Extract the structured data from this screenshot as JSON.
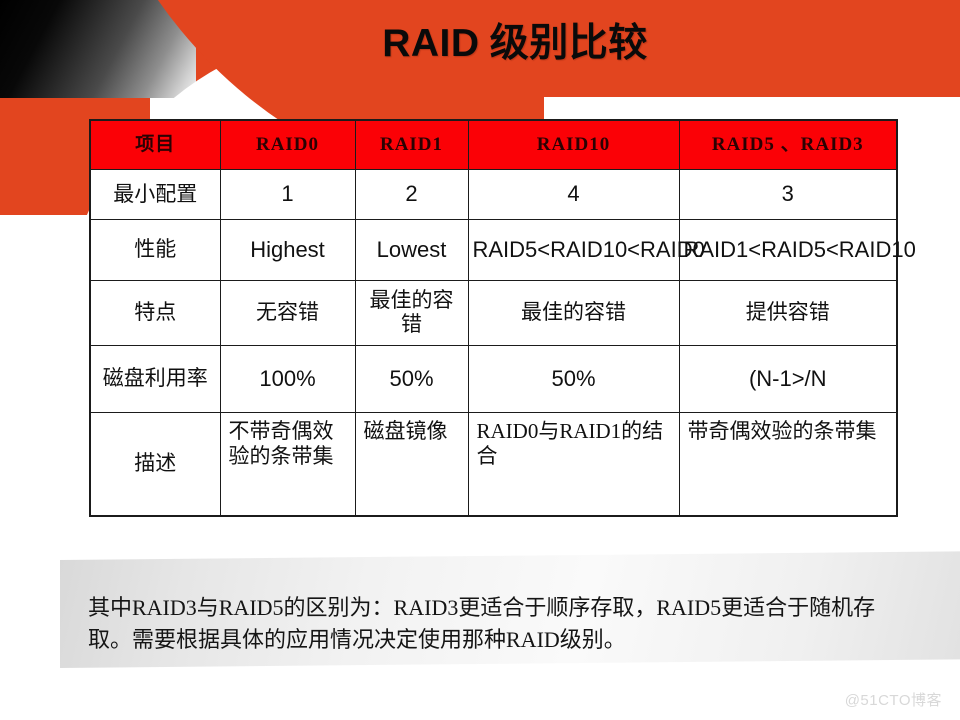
{
  "slide": {
    "title_latin": "RAID",
    "title_cjk": " 级别比较"
  },
  "table": {
    "headers": [
      "项目",
      "RAID0",
      "RAID1",
      "RAID10",
      "RAID5 、RAID3"
    ],
    "rows": [
      {
        "label": "最小配置",
        "cells": [
          "1",
          "2",
          "4",
          "3"
        ]
      },
      {
        "label": "性能",
        "cells": [
          "Highest",
          "Lowest",
          "RAID5<RAID10<RAID0",
          "RAID1<RAID5<RAID10"
        ]
      },
      {
        "label": "特点",
        "cells": [
          "无容错",
          "最佳的容错",
          "最佳的容错",
          "提供容错"
        ]
      },
      {
        "label": "磁盘利用率",
        "cells": [
          "100%",
          "50%",
          "50%",
          "(N-1>/N"
        ]
      },
      {
        "label": "描述",
        "cells": [
          "不带奇偶效验的条带集",
          "磁盘镜像",
          "RAID0与RAID1的结合",
          "带奇偶效验的条带集"
        ]
      }
    ]
  },
  "note": {
    "line1_a": "其中",
    "line1_b": "RAID3",
    "line1_c": "与",
    "line1_d": "RAID5",
    "line1_e": "的区别为：",
    "line1_f": "RAID3",
    "line1_g": "更适合于顺序存取，",
    "line1_h": "RAID5",
    "line1_i": "更适合于随机存取。需要根据具体的应用情况决定使用那种",
    "line1_j": "RAID",
    "line1_k": "级别。",
    "full_text": "其中RAID3与RAID5的区别为：RAID3更适合于顺序存取，RAID5更适合于随机存取。需要根据具体的应用情况决定使用那种RAID级别。"
  },
  "watermark": {
    "text": "@51CTO博客"
  },
  "colors": {
    "header_band": "#e2451f",
    "table_header_bg": "#fb0106",
    "table_header_text": "#2b0203",
    "table_border": "#1b1b1b",
    "note_panel": "#f2f2f2",
    "watermark": "#d8d8d8"
  }
}
